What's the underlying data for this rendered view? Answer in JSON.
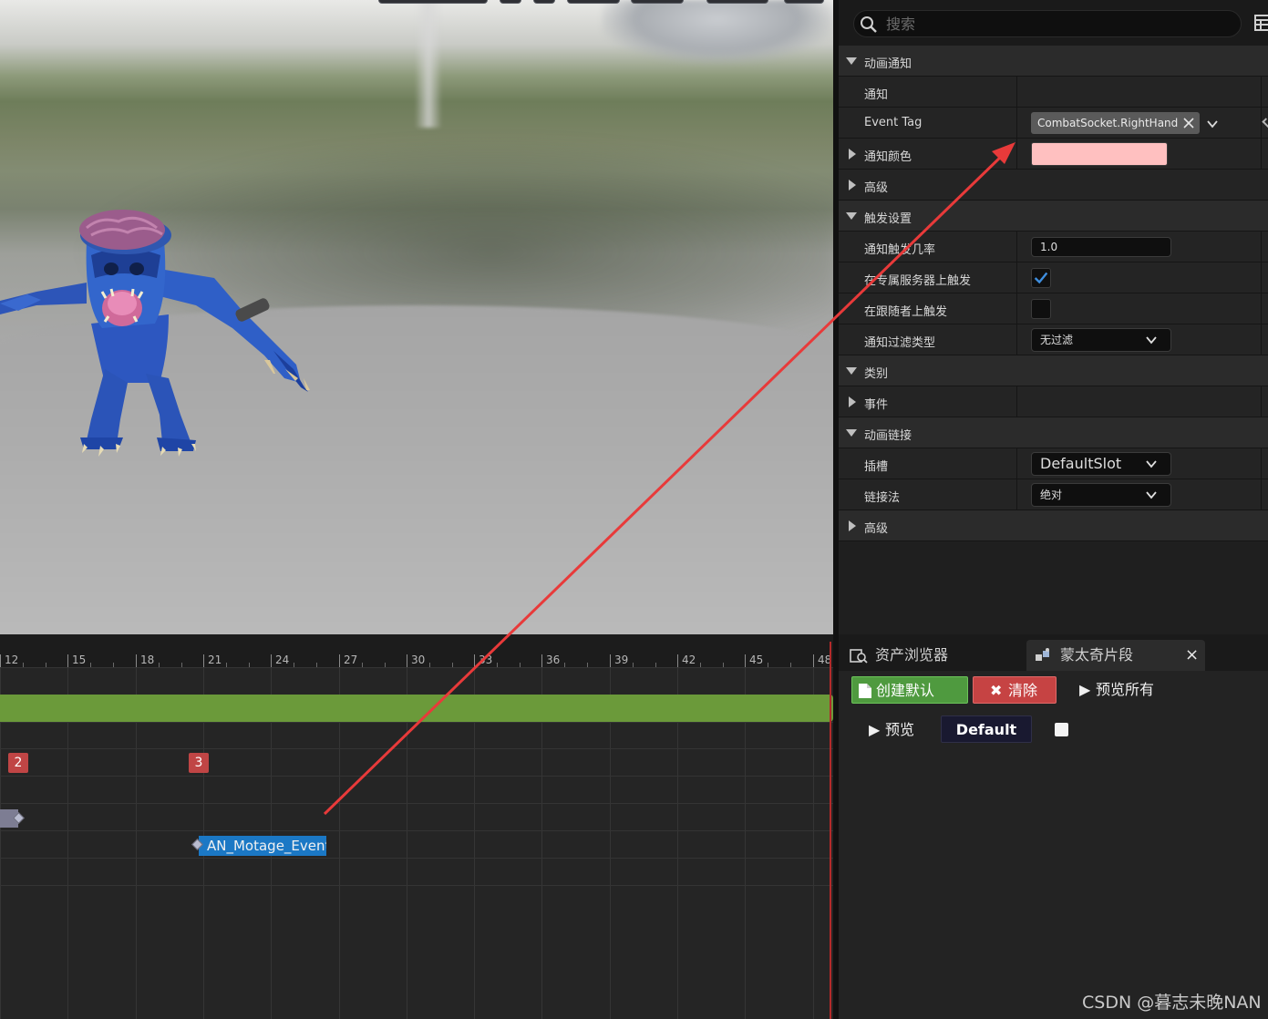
{
  "details": {
    "search_placeholder": "搜索",
    "rows": {
      "anim_notify_section": "动画通知",
      "notify_label": "通知",
      "event_tag_label": "Event Tag",
      "event_tag_value": "CombatSocket.RightHand",
      "notify_color_label": "通知颜色",
      "notify_color": "#ffc0c0",
      "advanced_label": "高级",
      "trigger_section": "触发设置",
      "trigger_chance_label": "通知触发几率",
      "trigger_chance_value": "1.0",
      "dedicated_server_label": "在专属服务器上触发",
      "dedicated_server_checked": true,
      "follower_label": "在跟随者上触发",
      "follower_checked": false,
      "filter_type_label": "通知过滤类型",
      "filter_type_value": "无过滤",
      "category_section": "类别",
      "event_label": "事件",
      "anim_link_section": "动画链接",
      "slot_label": "插槽",
      "slot_value": "DefaultSlot",
      "link_method_label": "链接法",
      "link_method_value": "绝对",
      "advanced2_label": "高级"
    }
  },
  "timeline": {
    "ticks": [
      "12",
      "15",
      "18",
      "21",
      "24",
      "27",
      "30",
      "33",
      "36",
      "39",
      "42",
      "45",
      "48"
    ],
    "markers": [
      "2",
      "3"
    ],
    "notify_name": "AN_Motage_Event"
  },
  "bottom_panel": {
    "tabs": [
      "资产浏览器",
      "蒙太奇片段"
    ],
    "close_glyph": "×",
    "create_default_label": "创建默认",
    "clear_label": "清除",
    "preview_all_label": "预览所有",
    "preview_label": "预览",
    "section_name": "Default"
  },
  "watermark": "CSDN @暮志未晚NAN",
  "colors": {
    "accent_red": "#e83a3a",
    "green_track": "#6b9a3a",
    "notify_blue": "#1b78c5"
  }
}
